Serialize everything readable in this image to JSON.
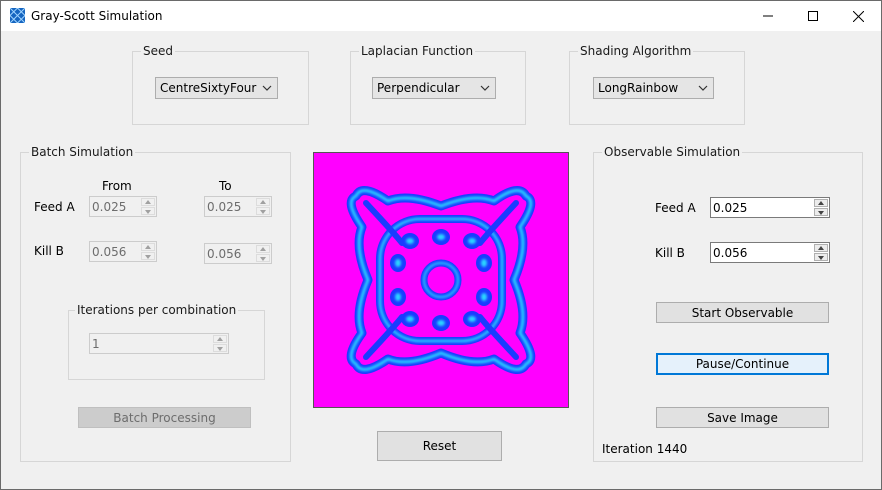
{
  "window": {
    "title": "Gray-Scott Simulation"
  },
  "seed": {
    "label": "Seed",
    "value": "CentreSixtyFour"
  },
  "laplacian": {
    "label": "Laplacian Function",
    "value": "Perpendicular"
  },
  "shading": {
    "label": "Shading Algorithm",
    "value": "LongRainbow"
  },
  "batch": {
    "label": "Batch Simulation",
    "from_label": "From",
    "to_label": "To",
    "feed_label": "Feed A",
    "kill_label": "Kill B",
    "feed_from": "0.025",
    "feed_to": "0.025",
    "kill_from": "0.056",
    "kill_to": "0.056",
    "iterations_label": "Iterations per combination",
    "iterations_value": "1",
    "process_button": "Batch Processing"
  },
  "reset_button": "Reset",
  "observable": {
    "label": "Observable Simulation",
    "feed_label": "Feed A",
    "feed_value": "0.025",
    "kill_label": "Kill B",
    "kill_value": "0.056",
    "start_button": "Start Observable",
    "pause_button": "Pause/Continue",
    "save_button": "Save Image",
    "iteration_text": "Iteration 1440"
  },
  "colors": {
    "background_magenta": "#ff00ff",
    "pattern_blue": "#1a3cff",
    "pattern_cyan": "#29d6ff"
  },
  "icons": {
    "app": "grid-icon",
    "dropdown": "chevron-down-icon"
  }
}
